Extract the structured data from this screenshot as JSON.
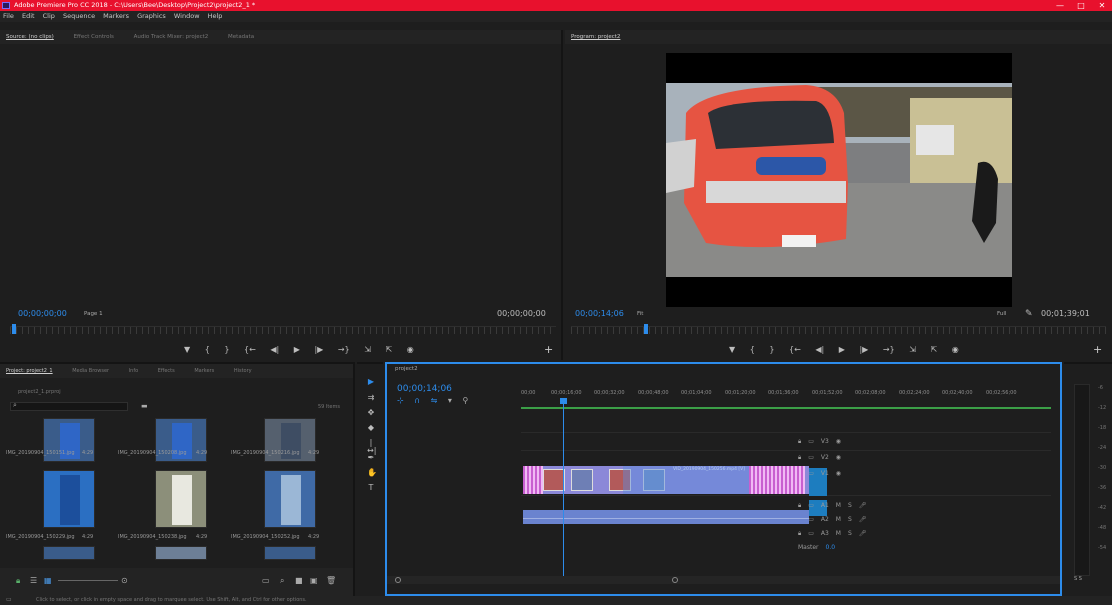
{
  "app": {
    "title": "Adobe Premiere Pro CC 2018 - C:\\Users\\Bee\\Desktop\\Project2\\project2_1 *",
    "min": "—",
    "max": "□",
    "close": "✕"
  },
  "menu": [
    "File",
    "Edit",
    "Clip",
    "Sequence",
    "Markers",
    "Graphics",
    "Window",
    "Help"
  ],
  "source": {
    "tabs": [
      "Source: (no clips)",
      "Effect Controls",
      "Audio Track Mixer: project2",
      "Metadata"
    ],
    "timecode_left": "00;00;00;00",
    "page": "Page 1",
    "timecode_right": "00;00;00;00"
  },
  "program": {
    "tab": "Program: project2",
    "timecode": "00;00;14;06",
    "fit": "Fit",
    "quality": "Full",
    "duration": "00;01;39;01"
  },
  "transport": {
    "buttons": [
      "▼",
      "{",
      "}",
      "{←",
      "◀|",
      "▶",
      "|▶",
      "→}",
      "⇲",
      "⇱",
      "◉"
    ],
    "add": "+"
  },
  "project": {
    "tabs": [
      "Project: project2_1",
      "Media Browser",
      "Info",
      "Effects",
      "Markers",
      "History"
    ],
    "file": "project2_1.prproj",
    "search_placeholder": "",
    "items_count": "59 Items",
    "thumbs": [
      {
        "name": "IMG_20190904_150151.jpg",
        "dur": "4:29"
      },
      {
        "name": "IMG_20190904_150208.jpg",
        "dur": "4:29"
      },
      {
        "name": "IMG_20190904_150216.jpg",
        "dur": "4:29"
      },
      {
        "name": "IMG_20190904_150229.jpg",
        "dur": "4:29"
      },
      {
        "name": "IMG_20190904_150238.jpg",
        "dur": "4:29"
      },
      {
        "name": "IMG_20190904_150252.jpg",
        "dur": "4:29"
      }
    ]
  },
  "timeline": {
    "tab": "project2",
    "timecode": "00;00;14;06",
    "ruler": [
      "00;00",
      "00;00;16;00",
      "00;00;32;00",
      "00;00;48;00",
      "00;01;04;00",
      "00;01;20;00",
      "00;01;36;00",
      "00;01;52;00",
      "00;02;08;00",
      "00;02;24;00",
      "00;02;40;00",
      "00;02;56;00"
    ],
    "tracks": [
      {
        "name": "V3",
        "label": "V3"
      },
      {
        "name": "V2",
        "label": "V2"
      },
      {
        "name": "V1",
        "label": "V1"
      },
      {
        "name": "A1",
        "label": "A1"
      },
      {
        "name": "A2",
        "label": "A2"
      },
      {
        "name": "A3",
        "label": "A3"
      }
    ],
    "master": "Master",
    "master_val": "0.0",
    "clip_label": "VID_20190904_150256.mp4 [V]"
  },
  "vu": {
    "labels": [
      "-6",
      "-12",
      "-18",
      "-24",
      "-30",
      "-36",
      "-42",
      "-48",
      "-54"
    ],
    "bottom": "S  S"
  },
  "status": "Click to select, or click in empty space and drag to marquee select. Use Shift, Alt, and Ctrl for other options."
}
